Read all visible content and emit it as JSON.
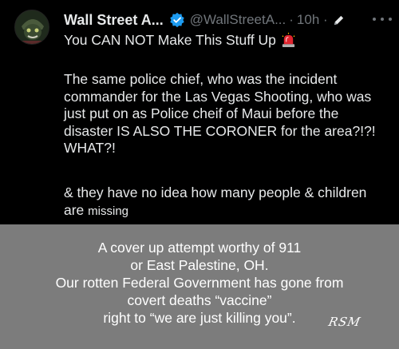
{
  "tweet": {
    "display_name": "Wall Street A...",
    "handle": "@WallStreetA...",
    "separator": "·",
    "time": "10h ·",
    "first_line": "You CAN NOT Make This Stuff Up",
    "paragraph_1": "The same police chief, who was the incident\ncommander for the Las Vegas Shooting, who was\njust put on as Police cheif of Maui before the\ndisaster IS ALSO THE CORONER for the area?!?!\nWHAT?!",
    "paragraph_2": "& they have no idea how many people & children",
    "paragraph_3_start": "are ",
    "paragraph_3_end": "missing",
    "icons": {
      "avatar": "avatar-image",
      "verified": "verified-badge-icon",
      "edit": "edited-pencil-icon",
      "siren": "siren-emoji-icon",
      "more": "more-options-icon"
    },
    "colors": {
      "background": "#000000",
      "text": "#e7e9ea",
      "muted": "#71767b",
      "verified": "#1d9bf0"
    }
  },
  "caption": {
    "text": "A cover up attempt worthy of 911\nor East Palestine, OH.\nOur rotten Federal Government has gone from\ncovert deaths “vaccine”\nright to “we are just killing you”.",
    "signature": "RSM",
    "background": "#7c7c7c"
  }
}
